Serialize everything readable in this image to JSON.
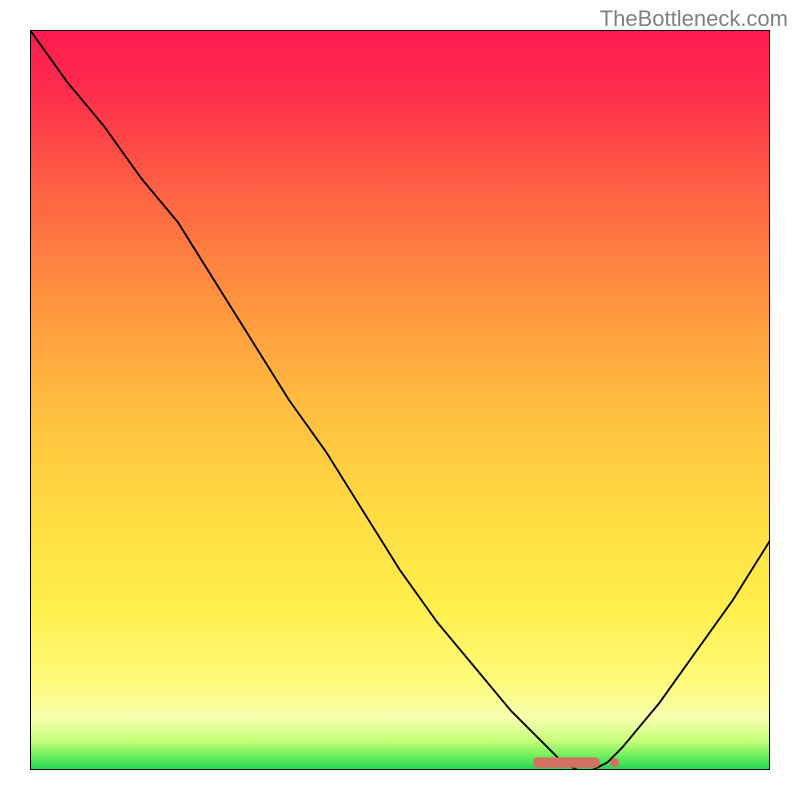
{
  "watermark": "TheBottleneck.com",
  "chart_data": {
    "type": "line",
    "x": [
      0,
      5,
      10,
      15,
      20,
      25,
      30,
      35,
      40,
      45,
      50,
      55,
      60,
      65,
      70,
      72,
      74,
      76,
      78,
      80,
      85,
      90,
      95,
      100
    ],
    "y": [
      100,
      93,
      87,
      80,
      74,
      66,
      58,
      50,
      43,
      35,
      27,
      20,
      14,
      8,
      3,
      1,
      0,
      0,
      1,
      3,
      9,
      16,
      23,
      31
    ],
    "xlabel": "",
    "ylabel": "",
    "xlim": [
      0,
      100
    ],
    "ylim": [
      0,
      100
    ],
    "marker": {
      "x_start": 68,
      "x_end": 79,
      "y": 1,
      "color": "#d27062"
    },
    "background": {
      "type": "vertical_gradient",
      "stops": [
        {
          "pos": 0.0,
          "color": "#ff1a4f"
        },
        {
          "pos": 0.45,
          "color": "#ffb347"
        },
        {
          "pos": 0.75,
          "color": "#ffe94a"
        },
        {
          "pos": 0.92,
          "color": "#fffca0"
        },
        {
          "pos": 0.97,
          "color": "#d6ff6e"
        },
        {
          "pos": 1.0,
          "color": "#1fd655"
        }
      ]
    }
  }
}
